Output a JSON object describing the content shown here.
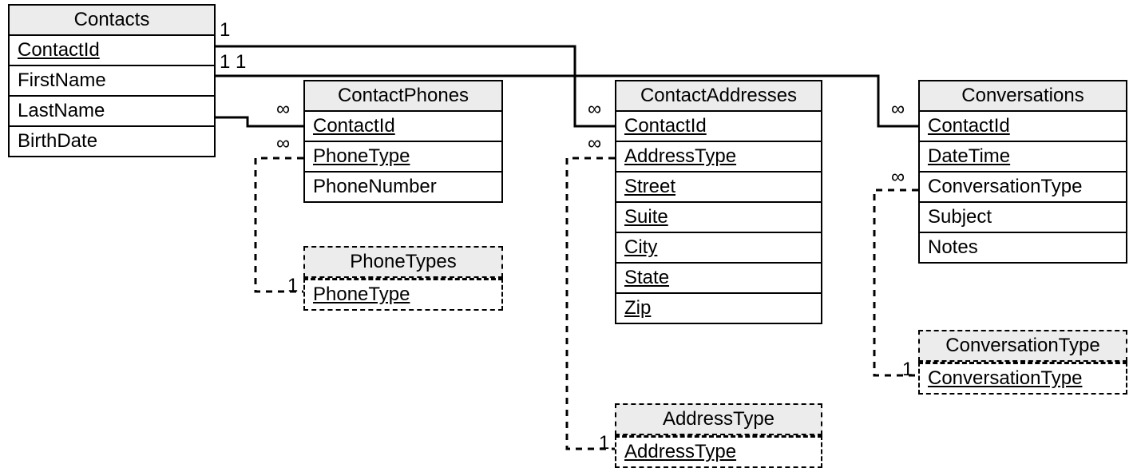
{
  "entities": {
    "contacts": {
      "title": "Contacts",
      "fields": [
        {
          "name": "ContactId",
          "underline": true
        },
        {
          "name": "FirstName",
          "underline": false
        },
        {
          "name": "LastName",
          "underline": false
        },
        {
          "name": "BirthDate",
          "underline": false
        }
      ]
    },
    "contactPhones": {
      "title": "ContactPhones",
      "fields": [
        {
          "name": "ContactId",
          "underline": true
        },
        {
          "name": "PhoneType",
          "underline": true
        },
        {
          "name": "PhoneNumber",
          "underline": false
        }
      ]
    },
    "phoneTypes": {
      "title": "PhoneTypes",
      "fields": [
        {
          "name": "PhoneType",
          "underline": true
        }
      ]
    },
    "contactAddresses": {
      "title": "ContactAddresses",
      "fields": [
        {
          "name": "ContactId",
          "underline": true
        },
        {
          "name": "AddressType",
          "underline": true
        },
        {
          "name": "Street",
          "underline": true
        },
        {
          "name": "Suite",
          "underline": true
        },
        {
          "name": "City",
          "underline": true
        },
        {
          "name": "State",
          "underline": true
        },
        {
          "name": "Zip",
          "underline": true
        }
      ]
    },
    "addressType": {
      "title": "AddressType",
      "fields": [
        {
          "name": "AddressType",
          "underline": true
        }
      ]
    },
    "conversations": {
      "title": "Conversations",
      "fields": [
        {
          "name": "ContactId",
          "underline": true
        },
        {
          "name": "DateTime",
          "underline": true
        },
        {
          "name": "ConversationType",
          "underline": false
        },
        {
          "name": "Subject",
          "underline": false
        },
        {
          "name": "Notes",
          "underline": false
        }
      ]
    },
    "conversationType": {
      "title": "ConversationType",
      "fields": [
        {
          "name": "ConversationType",
          "underline": true
        }
      ]
    }
  },
  "cardinality": {
    "one": "1",
    "many": "∞"
  }
}
